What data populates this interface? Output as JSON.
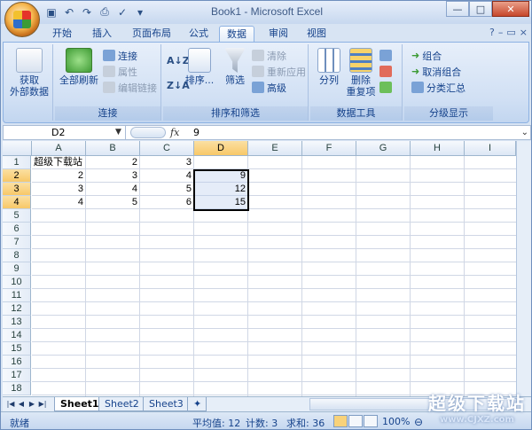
{
  "title": "Book1 - Microsoft Excel",
  "quick_access": {
    "icons": [
      "save-icon",
      "undo-icon",
      "redo-icon",
      "print-preview-icon",
      "spellcheck-icon",
      "customize-icon"
    ]
  },
  "window_controls": {
    "minimize": "—",
    "maximize": "□",
    "close": "✕"
  },
  "tabs": [
    {
      "label": "开始"
    },
    {
      "label": "插入"
    },
    {
      "label": "页面布局"
    },
    {
      "label": "公式"
    },
    {
      "label": "数据",
      "active": true
    },
    {
      "label": "审阅"
    },
    {
      "label": "视图"
    }
  ],
  "ribbon": {
    "get_external": {
      "label1": "获取",
      "label2": "外部数据"
    },
    "connections": {
      "refresh_all": "全部刷新",
      "connect": "连接",
      "properties": "属性",
      "edit_links": "编辑链接",
      "group": "连接"
    },
    "sort_filter": {
      "sort": "排序...",
      "filter": "筛选",
      "clear": "清除",
      "reapply": "重新应用",
      "advanced": "高级",
      "group": "排序和筛选"
    },
    "data_tools": {
      "text_to_columns": "分列",
      "remove_dup_1": "删除",
      "remove_dup_2": "重复项",
      "group": "数据工具"
    },
    "outline": {
      "group_btn": "组合",
      "ungroup_btn": "取消组合",
      "subtotal": "分类汇总",
      "group": "分级显示"
    }
  },
  "formula_bar": {
    "name_box": "D2",
    "fx": "fx",
    "value": "9"
  },
  "columns": [
    "A",
    "B",
    "C",
    "D",
    "E",
    "F",
    "G",
    "H",
    "I"
  ],
  "rows": [
    "1",
    "2",
    "3",
    "4",
    "5",
    "6",
    "7",
    "8",
    "9",
    "10",
    "11",
    "12",
    "13",
    "14",
    "15",
    "16",
    "17",
    "18"
  ],
  "cells": {
    "A1": "超级下载站",
    "B1": "2",
    "C1": "3",
    "A2": "2",
    "B2": "3",
    "C2": "4",
    "D2": "9",
    "A3": "3",
    "B3": "4",
    "C3": "5",
    "D3": "12",
    "A4": "4",
    "B4": "5",
    "C4": "6",
    "D4": "15"
  },
  "sheets": [
    "Sheet1",
    "Sheet2",
    "Sheet3"
  ],
  "status": {
    "ready": "就绪",
    "average": "平均值: 12",
    "count": "计数: 3",
    "sum": "求和: 36",
    "zoom": "100%"
  },
  "watermark": {
    "text": "超级下载站",
    "url": "www.CJXZ.com"
  }
}
